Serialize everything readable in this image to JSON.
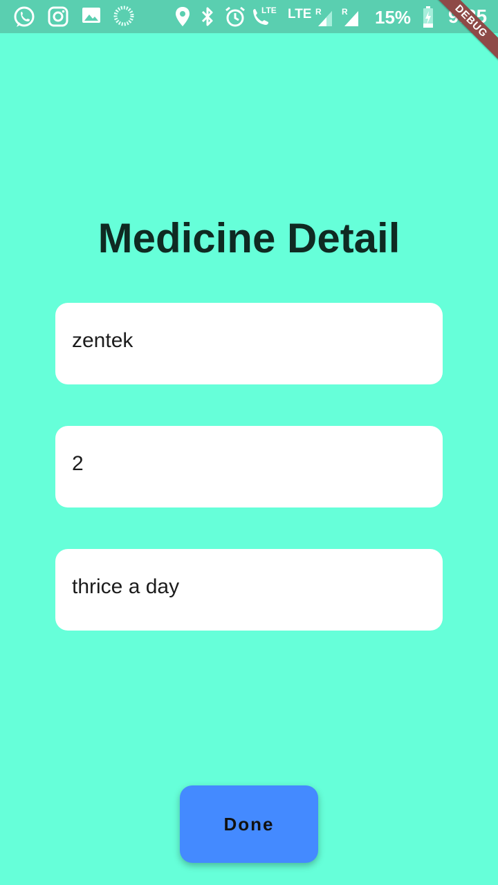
{
  "status_bar": {
    "network_label_1": "LTE",
    "network_label_2": "LTE",
    "roaming_label_1": "R",
    "roaming_label_2": "R",
    "battery": "15%",
    "time": "9:25",
    "icons": [
      "whatsapp-icon",
      "instagram-icon",
      "gallery-icon",
      "loading-icon",
      "location-icon",
      "bluetooth-icon",
      "alarm-icon",
      "volte-call-icon",
      "signal-icon",
      "signal-icon",
      "battery-charging-icon"
    ],
    "color": "#5ACFB0"
  },
  "debug_banner": "DEBUG",
  "page": {
    "title": "Medicine Detail",
    "background": "#66FFD9"
  },
  "form": {
    "fields": [
      {
        "value": "zentek"
      },
      {
        "value": "2"
      },
      {
        "value": "thrice a day"
      }
    ]
  },
  "actions": {
    "done_label": "Done",
    "done_color": "#448AFF"
  }
}
